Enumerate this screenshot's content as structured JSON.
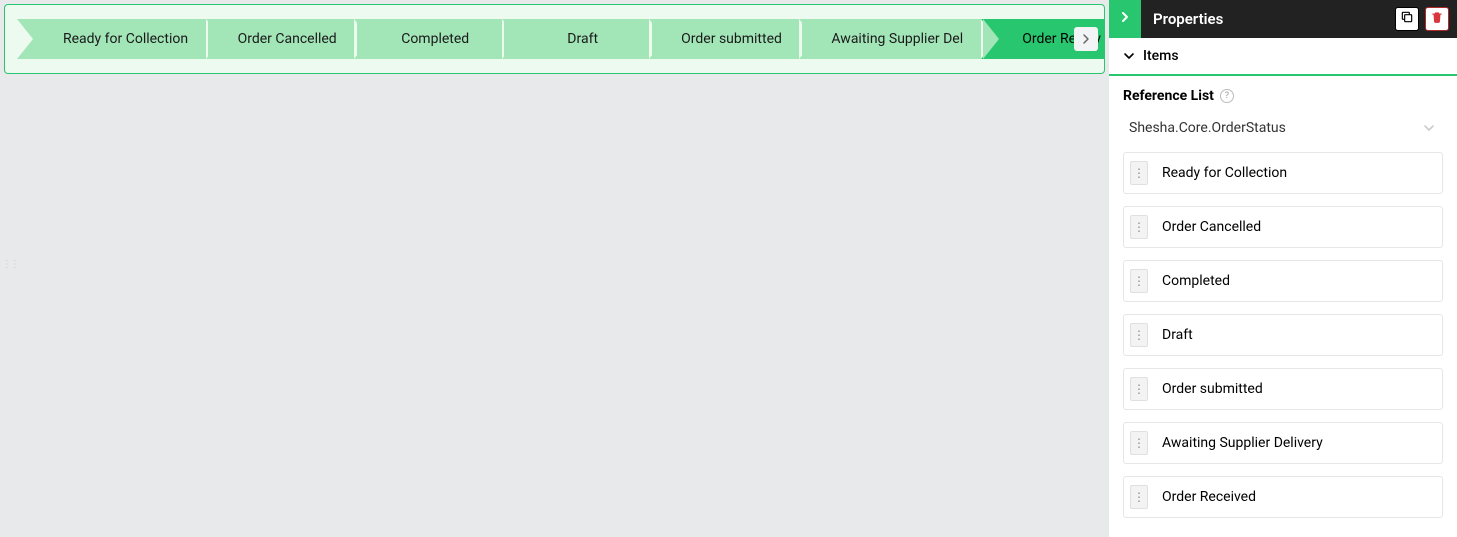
{
  "wizard": {
    "steps": [
      {
        "label": "Ready for Collection",
        "active": false
      },
      {
        "label": "Order Cancelled",
        "active": false
      },
      {
        "label": "Completed",
        "active": false
      },
      {
        "label": "Draft",
        "active": false
      },
      {
        "label": "Order submitted",
        "active": false
      },
      {
        "label": "Awaiting Supplier Del",
        "active": false
      },
      {
        "label": "Order Receiv",
        "active": true
      }
    ]
  },
  "properties": {
    "title": "Properties",
    "section": "Items",
    "referenceListLabel": "Reference List",
    "referenceListValue": "Shesha.Core.OrderStatus",
    "items": [
      "Ready for Collection",
      "Order Cancelled",
      "Completed",
      "Draft",
      "Order submitted",
      "Awaiting Supplier Delivery",
      "Order Received"
    ]
  }
}
